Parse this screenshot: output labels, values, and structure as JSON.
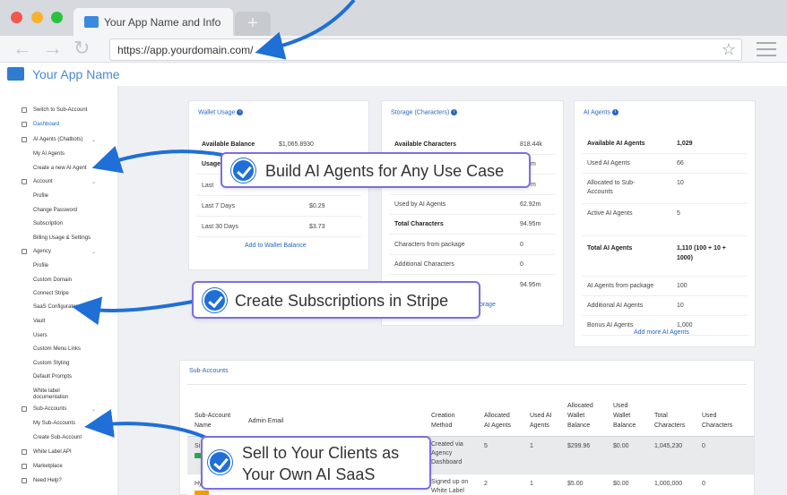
{
  "browser": {
    "tab_title": "Your App Name and Info",
    "new_tab": "+",
    "url": "https://app.yourdomain.com/",
    "dot_colors": [
      "#f2564f",
      "#f6b32b",
      "#28c33f"
    ]
  },
  "app": {
    "name": "Your App Name"
  },
  "sidebar": {
    "items": [
      {
        "label": "Switch to Sub-Account"
      },
      {
        "label": "Dashboard"
      },
      {
        "label": "AI Agents (Chatbots)"
      },
      {
        "label": "My AI Agents"
      },
      {
        "label": "Create a new AI Agent"
      },
      {
        "label": "Account"
      },
      {
        "label": "Profile"
      },
      {
        "label": "Change Password"
      },
      {
        "label": "Subscription"
      },
      {
        "label": "Billing Usage & Settings"
      },
      {
        "label": "Agency"
      },
      {
        "label": "Profile"
      },
      {
        "label": "Custom Domain"
      },
      {
        "label": "Connect Stripe"
      },
      {
        "label": "SaaS Configurator"
      },
      {
        "label": "Vault"
      },
      {
        "label": "Users"
      },
      {
        "label": "Custom Menu Links"
      },
      {
        "label": "Custom Styling"
      },
      {
        "label": "Default Prompts"
      },
      {
        "label": "White label"
      },
      {
        "label": "documentation"
      },
      {
        "label": "Sub-Accounts"
      },
      {
        "label": "My Sub-Accounts"
      },
      {
        "label": "Create Sub-Account"
      },
      {
        "label": "White Label API"
      },
      {
        "label": "Marketplace"
      },
      {
        "label": "Need Help?"
      }
    ]
  },
  "wallet": {
    "title": "Wallet Usage",
    "rows": [
      {
        "label": "Available Balance",
        "value": "$1,065.8930"
      },
      {
        "label": "Usage",
        "value": ""
      },
      {
        "label": "Last",
        "value": ""
      },
      {
        "label": "Last 7 Days",
        "value": "$0.29"
      },
      {
        "label": "Last 30 Days",
        "value": "$3.73"
      }
    ],
    "link": "Add to Wallet Balance"
  },
  "storage": {
    "title": "Storage (Characters)",
    "rows": [
      {
        "label": "Available Characters",
        "value": "818.44k"
      },
      {
        "label": "",
        "value": "m"
      },
      {
        "label": "",
        "value": "m"
      },
      {
        "label": "Used by AI Agents",
        "value": "62.92m"
      },
      {
        "label": "Total Characters",
        "value": "94.95m"
      },
      {
        "label": "Characters from package",
        "value": "0"
      },
      {
        "label": "Additional Characters",
        "value": "0"
      },
      {
        "label": "",
        "value": "94.95m"
      }
    ],
    "link": "torage"
  },
  "agents": {
    "title": "AI Agents",
    "rows": [
      {
        "label": "Available AI Agents",
        "value": "1,029"
      },
      {
        "label": "Used AI Agents",
        "value": "66"
      },
      {
        "label": "Allocated to Sub-",
        "label2": "Accounts",
        "value": "10"
      },
      {
        "label": "Active AI Agents",
        "value": "5"
      },
      {
        "label": "Total AI Agents",
        "value": "1,110 (100 + 10 +",
        "value2": "1000)"
      },
      {
        "label": "AI Agents from package",
        "value": "100"
      },
      {
        "label": "Additional AI Agents",
        "value": "10"
      },
      {
        "label": "Bonus AI Agents",
        "value": "1,000"
      }
    ],
    "link": "Add more AI Agents"
  },
  "subaccounts": {
    "title": "Sub-Accounts",
    "headers": [
      [
        "Sub-Account",
        "Name"
      ],
      [
        "Admin Email"
      ],
      [
        "Creation",
        "Method"
      ],
      [
        "Allocated",
        "AI Agents"
      ],
      [
        "Used AI",
        "Agents"
      ],
      [
        "Allocated",
        "Wallet",
        "Balance"
      ],
      [
        "Used",
        "Wallet",
        "Balance"
      ],
      [
        "Total",
        "Characters"
      ],
      [
        "Used",
        "Characters"
      ]
    ],
    "rows": [
      {
        "name": "Si",
        "creation": [
          "Created via",
          "Agency",
          "Dashboard"
        ],
        "alloc_agents": "5",
        "used_agents": "1",
        "alloc_wallet": "$299.96",
        "used_wallet": "$0.00",
        "total_chars": "1,045,230",
        "used_chars": "0"
      },
      {
        "name": "Hy",
        "creation": [
          "Signed up on",
          "White Label"
        ],
        "alloc_agents": "2",
        "used_agents": "1",
        "alloc_wallet": "$5.00",
        "used_wallet": "$0.00",
        "total_chars": "1,000,000",
        "used_chars": "0"
      }
    ]
  },
  "callouts": [
    {
      "text": "Build AI Agents for Any Use Case"
    },
    {
      "text": "Create Subscriptions in Stripe"
    },
    {
      "text": "Sell to Your Clients as",
      "text2": "Your Own AI SaaS"
    }
  ],
  "accent_color": "#1f6fd6"
}
